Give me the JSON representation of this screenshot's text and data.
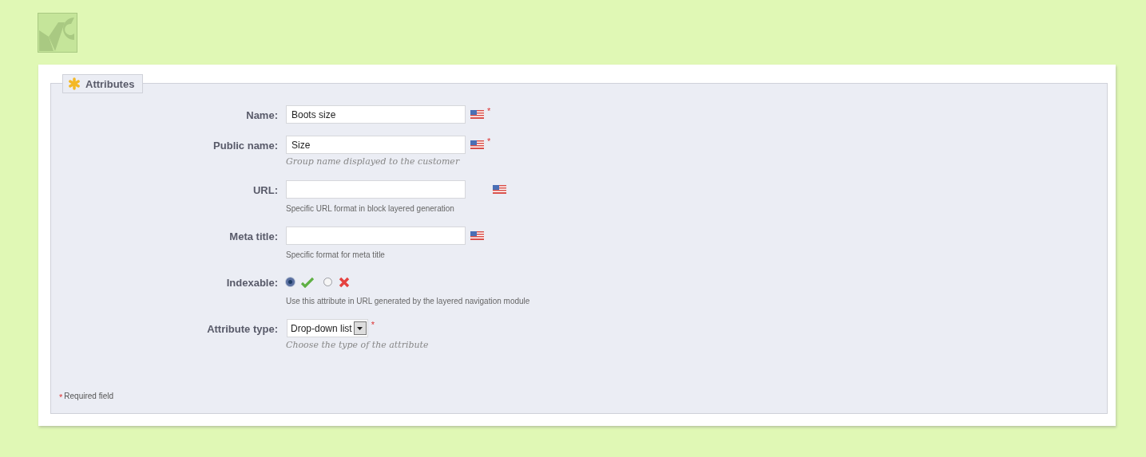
{
  "panel": {
    "title": "Attributes"
  },
  "fields": [
    {
      "kind": "text",
      "label": "Name:",
      "value": "Boots size",
      "flag": true,
      "required": true
    },
    {
      "kind": "text",
      "label": "Public name:",
      "value": "Size",
      "flag": true,
      "required": true,
      "hint": {
        "kind": "italic",
        "text": "Group name displayed to the customer"
      }
    },
    {
      "kind": "text",
      "label": "URL:",
      "flag": true,
      "required": false,
      "hint": {
        "kind": "plain",
        "text": "Specific URL format in block layered generation"
      }
    },
    {
      "kind": "text",
      "label": "Meta title:",
      "flag": true,
      "required": false,
      "hint": {
        "kind": "plain",
        "text": "Specific format for meta title"
      }
    },
    {
      "kind": "radio",
      "label": "Indexable:",
      "options": [
        {
          "kind": "yes",
          "selected": true
        },
        {
          "kind": "no",
          "selected": false
        }
      ],
      "required": false,
      "hint": {
        "kind": "plain",
        "text": "Use this attribute in URL generated by the layered navigation module"
      }
    },
    {
      "kind": "select",
      "label": "Attribute type:",
      "value": "Drop-down list",
      "required": true,
      "hint": {
        "kind": "italic",
        "text": "Choose the type of the attribute"
      }
    }
  ],
  "required_note": {
    "mark": "*",
    "text": "Required field"
  }
}
